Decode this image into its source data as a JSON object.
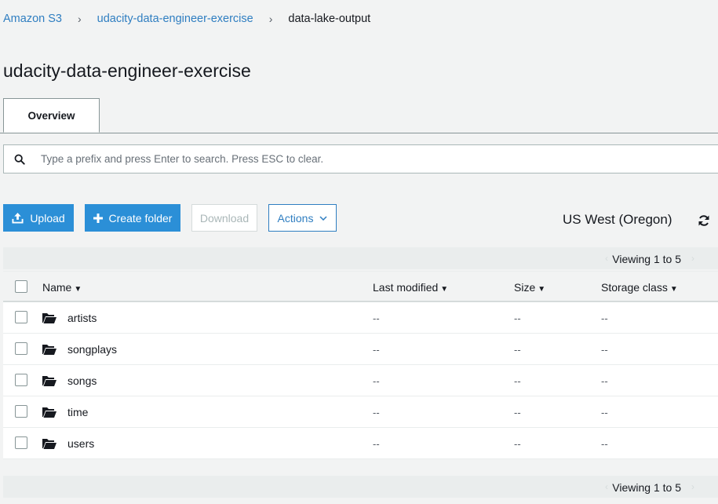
{
  "breadcrumb": {
    "root": "Amazon S3",
    "bucket": "udacity-data-engineer-exercise",
    "current": "data-lake-output",
    "separator": "›"
  },
  "page_title": "udacity-data-engineer-exercise",
  "tabs": [
    {
      "label": "Overview",
      "active": true
    }
  ],
  "search": {
    "placeholder": "Type a prefix and press Enter to search. Press ESC to clear.",
    "value": ""
  },
  "toolbar": {
    "upload_label": "Upload",
    "create_folder_label": "Create folder",
    "download_label": "Download",
    "actions_label": "Actions"
  },
  "region": "US West (Oregon)",
  "pagination": {
    "label": "Viewing 1 to 5"
  },
  "table": {
    "columns": {
      "name": "Name",
      "last_modified": "Last modified",
      "size": "Size",
      "storage_class": "Storage class"
    },
    "rows": [
      {
        "name": "artists",
        "last_modified": "--",
        "size": "--",
        "storage_class": "--"
      },
      {
        "name": "songplays",
        "last_modified": "--",
        "size": "--",
        "storage_class": "--"
      },
      {
        "name": "songs",
        "last_modified": "--",
        "size": "--",
        "storage_class": "--"
      },
      {
        "name": "time",
        "last_modified": "--",
        "size": "--",
        "storage_class": "--"
      },
      {
        "name": "users",
        "last_modified": "--",
        "size": "--",
        "storage_class": "--"
      }
    ]
  },
  "colors": {
    "link": "#2f7ec1",
    "primary": "#2b8fd7",
    "background": "#f2f3f3"
  },
  "icons": [
    "search-icon",
    "upload-icon",
    "plus-icon",
    "chevron-down-icon",
    "refresh-icon",
    "folder-icon",
    "caret-down-icon"
  ]
}
